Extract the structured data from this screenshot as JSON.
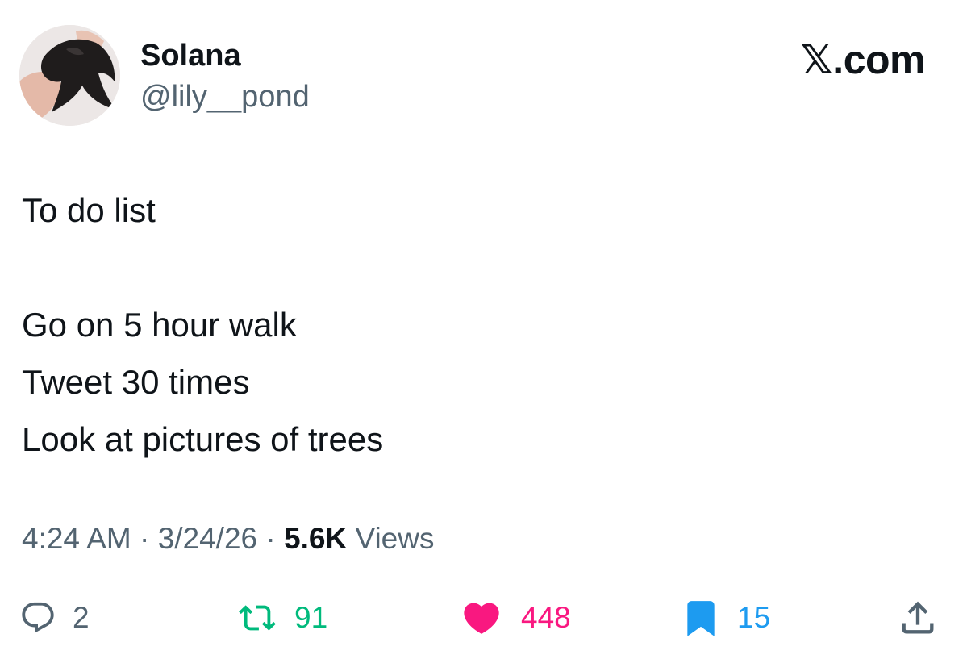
{
  "author": {
    "display_name": "Solana",
    "handle": "@lily__pond",
    "avatar_icon": "bird-avatar-icon"
  },
  "brand": {
    "x_glyph": "𝕏",
    "domain": ".com"
  },
  "tweet": {
    "lines": [
      "To do list",
      "",
      "Go on 5 hour walk",
      "Tweet 30 times",
      "Look at pictures of trees"
    ]
  },
  "meta": {
    "time": "4:24 AM",
    "date": "3/24/26",
    "separator": "·",
    "views_count": "5.6K",
    "views_label": "Views"
  },
  "actions": {
    "reply": {
      "icon": "reply-icon",
      "count": "2"
    },
    "retweet": {
      "icon": "retweet-icon",
      "count": "91"
    },
    "like": {
      "icon": "heart-icon",
      "count": "448"
    },
    "bookmark": {
      "icon": "bookmark-icon",
      "count": "15"
    },
    "share": {
      "icon": "share-icon"
    }
  },
  "colors": {
    "text": "#0f1419",
    "secondary": "#536471",
    "retweet": "#00ba7c",
    "like": "#f91880",
    "bookmark": "#1d9bf0"
  }
}
